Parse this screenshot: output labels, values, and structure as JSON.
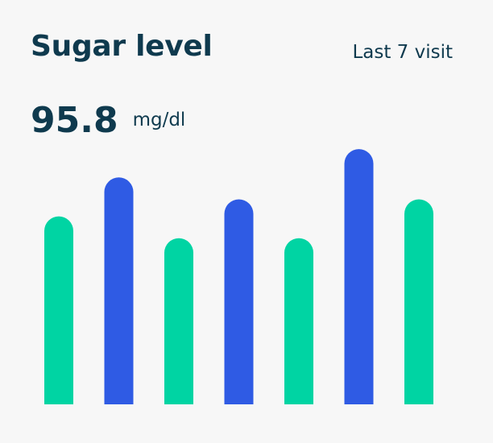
{
  "card": {
    "title": "Sugar level",
    "range_label": "Last 7 visit",
    "value": "95.8",
    "unit": "mg/dl"
  },
  "colors": {
    "accent_green": "#00d4a3",
    "accent_blue": "#2f5be4",
    "text": "#0f3a4e",
    "background": "#f7f7f7"
  },
  "chart_data": {
    "type": "bar",
    "title": "Sugar level",
    "categories": [
      "",
      "",
      "",
      "",
      "",
      "",
      ""
    ],
    "values": [
      232,
      280,
      205,
      253,
      205,
      315,
      253
    ],
    "bar_colors": [
      "#00d4a3",
      "#2f5be4",
      "#00d4a3",
      "#2f5be4",
      "#00d4a3",
      "#2f5be4",
      "#00d4a3"
    ],
    "ylim": [
      0,
      330
    ],
    "grid": false,
    "legend": "none",
    "xlabel": "",
    "ylabel": ""
  }
}
